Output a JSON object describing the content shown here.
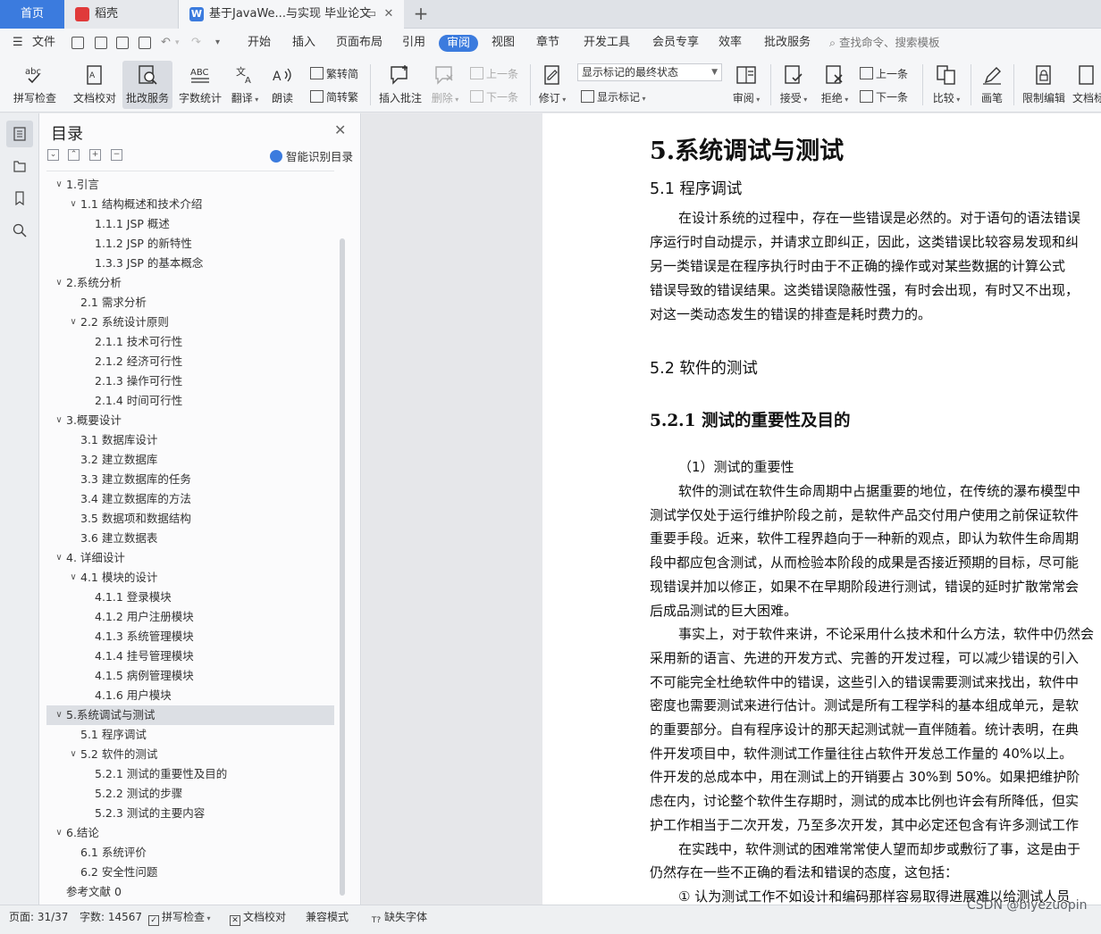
{
  "tabs": {
    "home": "首页",
    "daoke": "稻壳",
    "doc": "基于JavaWe...与实现 毕业论文"
  },
  "menu": {
    "file": "文件",
    "items": [
      "开始",
      "插入",
      "页面布局",
      "引用",
      "审阅",
      "视图",
      "章节",
      "开发工具",
      "会员专享",
      "效率",
      "批改服务"
    ],
    "active": "审阅",
    "search_placeholder": "查找命令、搜索模板"
  },
  "ribbon": {
    "spellcheck": "拼写检查",
    "doc_proof": "文档校对",
    "review_service": "批改服务",
    "word_count": "字数统计",
    "translate": "翻译",
    "read_aloud": "朗读",
    "trad_to_simp": "繁转简",
    "simp_to_trad": "简转繁",
    "insert_comment": "插入批注",
    "delete": "删除",
    "prev_comment": "上一条",
    "next_comment": "下一条",
    "track_changes": "修订",
    "markup_mode": "显示标记的最终状态",
    "show_markup": "显示标记",
    "review_pane": "审阅",
    "accept": "接受",
    "reject": "拒绝",
    "prev_change": "上一条",
    "next_change": "下一条",
    "compare": "比较",
    "ink": "画笔",
    "restrict_edit": "限制编辑",
    "doc_more": "文档标"
  },
  "toc": {
    "title": "目录",
    "ai_label": "智能识别目录",
    "items": [
      {
        "text": "1.引言",
        "level": 1,
        "expanded": true
      },
      {
        "text": "1.1 结构概述和技术介绍",
        "level": 2,
        "expanded": true
      },
      {
        "text": "1.1.1 JSP 概述",
        "level": 3
      },
      {
        "text": "1.1.2 JSP 的新特性",
        "level": 3
      },
      {
        "text": "1.3.3 JSP 的基本概念",
        "level": 3
      },
      {
        "text": "2.系统分析",
        "level": 1,
        "expanded": true
      },
      {
        "text": "2.1  需求分析",
        "level": 2
      },
      {
        "text": "2.2  系统设计原则",
        "level": 2,
        "expanded": true
      },
      {
        "text": "2.1.1 技术可行性",
        "level": 3
      },
      {
        "text": "2.1.2  经济可行性",
        "level": 3
      },
      {
        "text": "2.1.3  操作可行性",
        "level": 3
      },
      {
        "text": "2.1.4  时间可行性",
        "level": 3
      },
      {
        "text": "3.概要设计",
        "level": 1,
        "expanded": true
      },
      {
        "text": "3.1  数据库设计",
        "level": 2
      },
      {
        "text": "3.2  建立数据库",
        "level": 2
      },
      {
        "text": "3.3 建立数据库的任务",
        "level": 2
      },
      {
        "text": "3.4  建立数据库的方法",
        "level": 2
      },
      {
        "text": "3.5  数据项和数据结构",
        "level": 2
      },
      {
        "text": "3.6  建立数据表",
        "level": 2
      },
      {
        "text": "4.  详细设计",
        "level": 1,
        "expanded": true
      },
      {
        "text": "4.1  模块的设计",
        "level": 2,
        "expanded": true
      },
      {
        "text": "4.1.1  登录模块",
        "level": 3
      },
      {
        "text": "4.1.2  用户注册模块",
        "level": 3
      },
      {
        "text": "4.1.3  系统管理模块",
        "level": 3
      },
      {
        "text": "4.1.4  挂号管理模块",
        "level": 3
      },
      {
        "text": "4.1.5 病例管理模块",
        "level": 3
      },
      {
        "text": "4.1.6 用户模块",
        "level": 3
      },
      {
        "text": "5.系统调试与测试",
        "level": 1,
        "expanded": true,
        "selected": true
      },
      {
        "text": "5.1  程序调试",
        "level": 2
      },
      {
        "text": "5.2  软件的测试",
        "level": 2,
        "expanded": true
      },
      {
        "text": "5.2.1  测试的重要性及目的",
        "level": 3
      },
      {
        "text": "5.2.2  测试的步骤",
        "level": 3
      },
      {
        "text": "5.2.3  测试的主要内容",
        "level": 3
      },
      {
        "text": "6.结论",
        "level": 1,
        "expanded": true
      },
      {
        "text": "6.1  系统评价",
        "level": 2
      },
      {
        "text": "6.2  安全性问题",
        "level": 2
      },
      {
        "text": "参考文献 0",
        "level": 1
      }
    ]
  },
  "document": {
    "h1": "5.系统调试与测试",
    "h2_debug": "5.1  程序调试",
    "debug_lines": [
      "在设计系统的过程中，存在一些错误是必然的。对于语句的语法错误",
      "序运行时自动提示，并请求立即纠正，因此，这类错误比较容易发现和纠",
      "另一类错误是在程序执行时由于不正确的操作或对某些数据的计算公式",
      "错误导致的错误结果。这类错误隐蔽性强，有时会出现，有时又不出现，",
      "对这一类动态发生的错误的排查是耗时费力的。"
    ],
    "h2_test": "5.2  软件的测试",
    "h3": "5.2.1  测试的重要性及目的",
    "sub1": "（1）测试的重要性",
    "body_lines": [
      "软件的测试在软件生命周期中占据重要的地位，在传统的瀑布模型中",
      "测试学仅处于运行维护阶段之前，是软件产品交付用户使用之前保证软件",
      "重要手段。近来，软件工程界趋向于一种新的观点，即认为软件生命周期",
      "段中都应包含测试，从而检验本阶段的成果是否接近预期的目标，尽可能",
      "现错误并加以修正，如果不在早期阶段进行测试，错误的延时扩散常常会",
      "后成品测试的巨大困难。",
      "事实上，对于软件来讲，不论采用什么技术和什么方法，软件中仍然会",
      "采用新的语言、先进的开发方式、完善的开发过程，可以减少错误的引入",
      "不可能完全杜绝软件中的错误，这些引入的错误需要测试来找出，软件中",
      "密度也需要测试来进行估计。测试是所有工程学科的基本组成单元，是软",
      "的重要部分。自有程序设计的那天起测试就一直伴随着。统计表明，在典",
      "件开发项目中，软件测试工作量往往占软件开发总工作量的 40%以上。",
      "件开发的总成本中，用在测试上的开销要占 30%到 50%。如果把维护阶",
      "虑在内，讨论整个软件生存期时，测试的成本比例也许会有所降低，但实",
      "护工作相当于二次开发，乃至多次开发，其中必定还包含有许多测试工作",
      "在实践中，软件测试的困难常常使人望而却步或敷衍了事，这是由于",
      "仍然存在一些不正确的看法和错误的态度，这包括：",
      "①  认为测试工作不如设计和编码那样容易取得进展难以给测试人员"
    ]
  },
  "status": {
    "page": "页面: 31/37",
    "words": "字数: 14567",
    "spellcheck": "拼写检查",
    "proof": "文档校对",
    "compat": "兼容模式",
    "missing_font": "缺失字体"
  },
  "watermark": "CSDN @biyezuopin",
  "colors": {
    "accent": "#3b7bde",
    "daoke_red": "#e03a3a"
  }
}
